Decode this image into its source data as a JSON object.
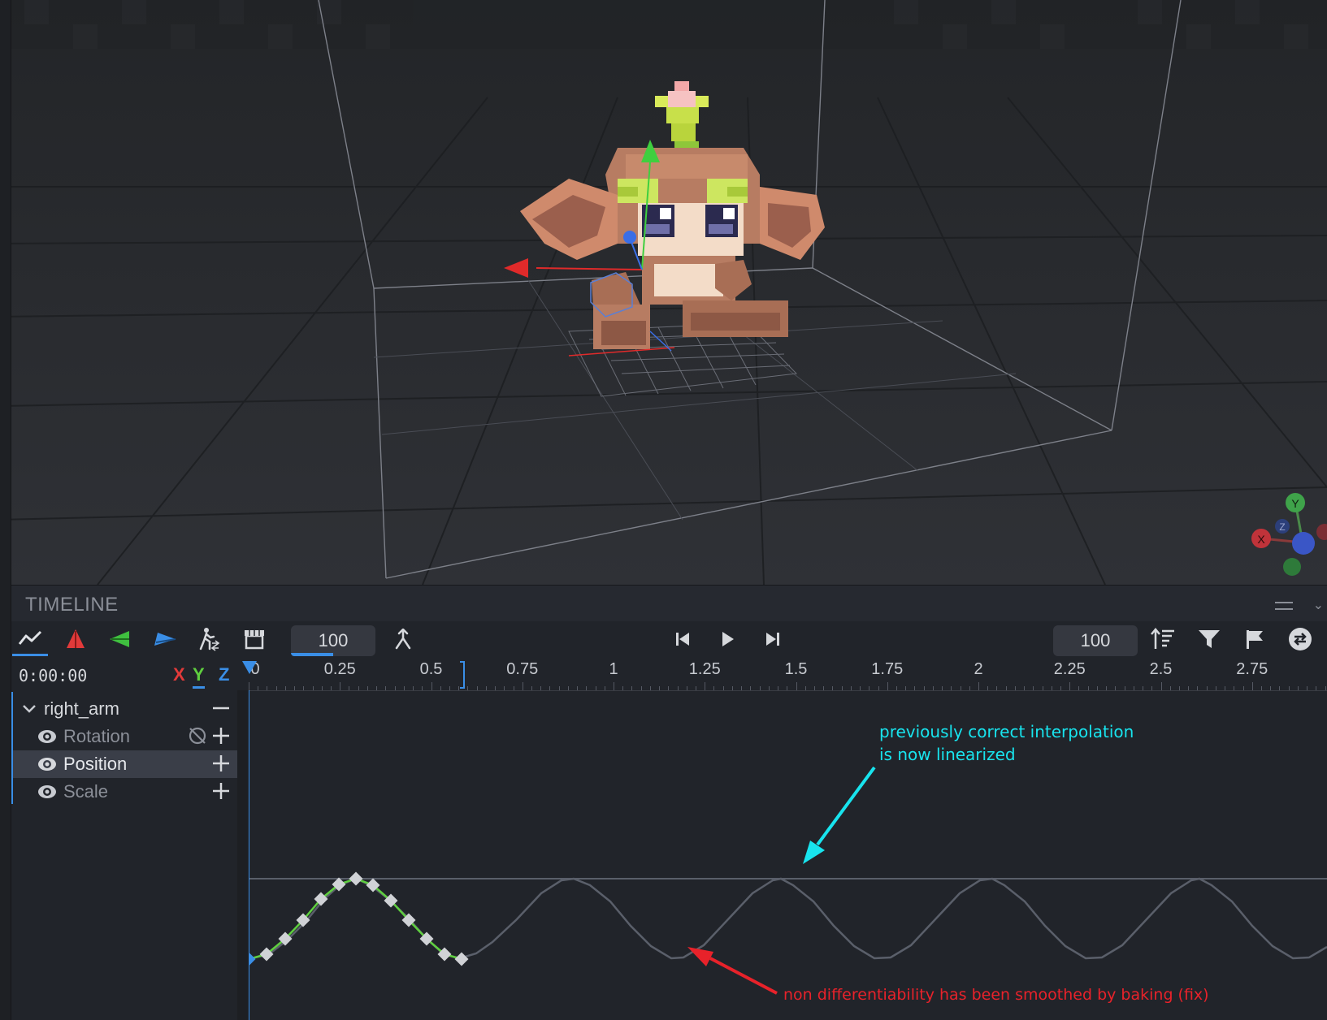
{
  "viewport": {
    "gizmo_axes": {
      "x": "X",
      "y": "Y",
      "z": "Z"
    }
  },
  "timeline": {
    "title": "TIMELINE",
    "toolbar": {
      "tools": [
        {
          "name": "graph-editor-icon",
          "active": true
        },
        {
          "name": "rotation-channel-icon",
          "color": "#e23a3a"
        },
        {
          "name": "position-channel-icon",
          "color": "#3fbf3f"
        },
        {
          "name": "scale-channel-icon",
          "color": "#3a8ee6"
        },
        {
          "name": "walk-cycle-icon"
        },
        {
          "name": "store-icon"
        }
      ],
      "snap_value": "100",
      "playback_speed": "100"
    },
    "timecode": "0:00:00",
    "axes": {
      "x": "X",
      "y": "Y",
      "z": "Z",
      "active": "Y"
    },
    "ruler_labels": [
      "0",
      "0.25",
      "0.5",
      "0.75",
      "1",
      "1.25",
      "1.5",
      "1.75",
      "2",
      "2.25",
      "2.5",
      "2.75"
    ],
    "bone": {
      "name": "right_arm",
      "channels": [
        {
          "label": "Rotation",
          "selected": false,
          "muted": true
        },
        {
          "label": "Position",
          "selected": true,
          "muted": false
        },
        {
          "label": "Scale",
          "selected": false,
          "muted": true
        }
      ]
    },
    "annotations": {
      "cyan": [
        "previously correct interpolation",
        "is now linearized"
      ],
      "red": "non differentiability has been smoothed by baking (fix)"
    },
    "colors": {
      "accent": "#3a8ee6",
      "curve_active": "#5fcf3f",
      "curve_ghost": "#5a5f6a",
      "annotation_cyan": "#18e4ee",
      "annotation_red": "#e8222a"
    }
  }
}
